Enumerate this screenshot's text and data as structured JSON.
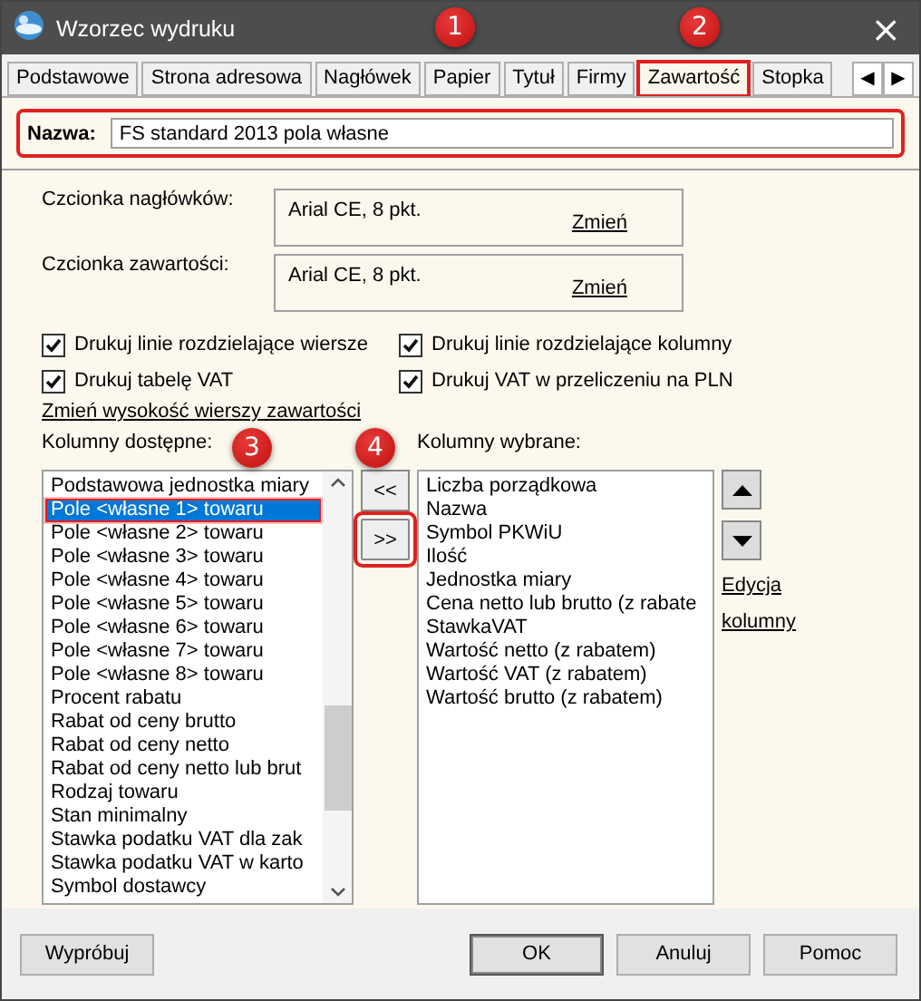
{
  "window": {
    "title": "Wzorzec wydruku",
    "close": "×"
  },
  "tabs": [
    {
      "label": "Podstawowe",
      "selected": false,
      "highlighted": false
    },
    {
      "label": "Strona adresowa",
      "selected": false,
      "highlighted": false
    },
    {
      "label": "Nagłówek",
      "selected": false,
      "highlighted": false
    },
    {
      "label": "Papier",
      "selected": false,
      "highlighted": false
    },
    {
      "label": "Tytuł",
      "selected": false,
      "highlighted": false
    },
    {
      "label": "Firmy",
      "selected": false,
      "highlighted": false
    },
    {
      "label": "Zawartość",
      "selected": true,
      "highlighted": true
    },
    {
      "label": "Stopka",
      "selected": false,
      "highlighted": false
    }
  ],
  "tab_scroll": [
    "◀",
    "▶"
  ],
  "name_field": {
    "label": "Nazwa:",
    "value": "FS standard 2013 pola własne",
    "highlighted": true
  },
  "fonts": [
    {
      "label": "Czcionka nagłówków:",
      "value": "Arial CE, 8 pkt.",
      "link": "Zmień"
    },
    {
      "label": "Czcionka zawartości:",
      "value": "Arial CE, 8 pkt.",
      "link": "Zmień"
    }
  ],
  "options": [
    {
      "label": "Drukuj linie rozdzielające wiersze",
      "checked": true
    },
    {
      "label": "Drukuj linie rozdzielające kolumny",
      "checked": true
    },
    {
      "label": "Drukuj tabelę VAT",
      "checked": true
    },
    {
      "label": "Drukuj VAT w przeliczeniu na PLN",
      "checked": true
    }
  ],
  "row_height_link": "Zmień wysokość wierszy zawartości",
  "available": {
    "label": "Kolumny dostępne:",
    "items": [
      {
        "text": "Podstawowa jednostka miary",
        "selected": false,
        "highlighted": false
      },
      {
        "text": "Pole <własne 1> towaru",
        "selected": true,
        "highlighted": true
      },
      {
        "text": "Pole <własne 2> towaru",
        "selected": false,
        "highlighted": false
      },
      {
        "text": "Pole <własne 3> towaru",
        "selected": false,
        "highlighted": false
      },
      {
        "text": "Pole <własne 4> towaru",
        "selected": false,
        "highlighted": false
      },
      {
        "text": "Pole <własne 5> towaru",
        "selected": false,
        "highlighted": false
      },
      {
        "text": "Pole <własne 6> towaru",
        "selected": false,
        "highlighted": false
      },
      {
        "text": "Pole <własne 7> towaru",
        "selected": false,
        "highlighted": false
      },
      {
        "text": "Pole <własne 8> towaru",
        "selected": false,
        "highlighted": false
      },
      {
        "text": "Procent rabatu",
        "selected": false,
        "highlighted": false
      },
      {
        "text": "Rabat od ceny brutto",
        "selected": false,
        "highlighted": false
      },
      {
        "text": "Rabat od ceny netto",
        "selected": false,
        "highlighted": false
      },
      {
        "text": "Rabat od ceny netto lub brut",
        "selected": false,
        "highlighted": false
      },
      {
        "text": "Rodzaj towaru",
        "selected": false,
        "highlighted": false
      },
      {
        "text": "Stan minimalny",
        "selected": false,
        "highlighted": false
      },
      {
        "text": "Stawka podatku VAT dla zak",
        "selected": false,
        "highlighted": false
      },
      {
        "text": "Stawka podatku VAT w karto",
        "selected": false,
        "highlighted": false
      },
      {
        "text": "Symbol dostawcy",
        "selected": false,
        "highlighted": false
      }
    ]
  },
  "move_buttons": [
    {
      "label": "<<",
      "highlighted": false
    },
    {
      "label": ">>",
      "highlighted": true
    }
  ],
  "selected_columns": {
    "label": "Kolumny wybrane:",
    "items": [
      "Liczba porządkowa",
      "Nazwa",
      "Symbol PKWiU",
      "Ilość",
      "Jednostka miary",
      "Cena netto lub brutto (z rabate",
      "StawkaVAT",
      "Wartość netto (z rabatem)",
      "Wartość VAT (z rabatem)",
      "Wartość brutto (z rabatem)"
    ]
  },
  "edit_link": "Edycja kolumny",
  "footer": {
    "left": [
      "Wypróbuj"
    ],
    "right": [
      "OK",
      "Anuluj",
      "Pomoc"
    ]
  },
  "annotations": [
    {
      "number": "1"
    },
    {
      "number": "2"
    },
    {
      "number": "3"
    },
    {
      "number": "4"
    }
  ]
}
